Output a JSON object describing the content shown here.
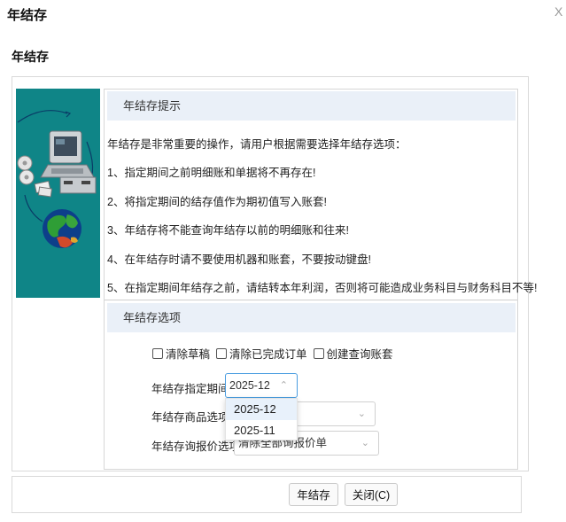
{
  "window": {
    "title": "年结存",
    "close": "X"
  },
  "page": {
    "title": "年结存"
  },
  "tips": {
    "header": "年结存提示",
    "intro": "年结存是非常重要的操作，请用户根据需要选择年结存选项：",
    "items": [
      "1、指定期间之前明细账和单据将不再存在!",
      "2、将指定期间的结存值作为期初值写入账套!",
      "3、年结存将不能查询年结存以前的明细账和往来!",
      "4、在年结存时请不要使用机器和账套，不要按动键盘!",
      "5、在指定期间年结存之前，请结转本年利润，否则将可能造成业务科目与财务科目不等!"
    ]
  },
  "options": {
    "header": "年结存选项",
    "checkboxes": [
      {
        "label": "清除草稿",
        "checked": false
      },
      {
        "label": "清除已完成订单",
        "checked": false
      },
      {
        "label": "创建查询账套",
        "checked": false
      }
    ],
    "period": {
      "label": "年结存指定期间",
      "value": "2025-12",
      "options": [
        "2025-12",
        "2025-11"
      ]
    },
    "goods": {
      "label": "年结存商品选项",
      "value": ""
    },
    "quote": {
      "label": "年结存询报价选项",
      "value": "清除全部询报价单"
    }
  },
  "buttons": {
    "confirm": "年结存",
    "close": "关闭(C)"
  },
  "colors": {
    "illustration_bg": "#0f8587",
    "section_bg": "#eaf0f8",
    "dropdown_selected": "#e8f1fb",
    "focus": "#4a9de0"
  }
}
